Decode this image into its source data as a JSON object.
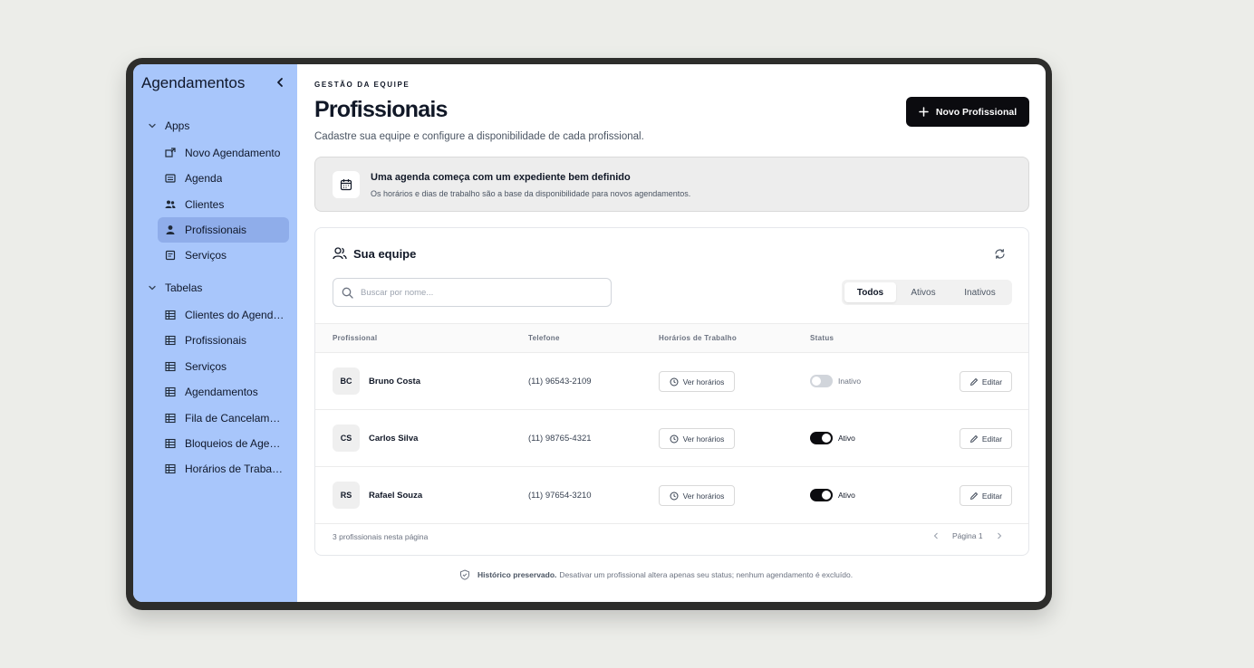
{
  "sidebar": {
    "title": "Agendamentos",
    "sections": [
      {
        "label": "Apps"
      },
      {
        "label": "Tabelas"
      }
    ],
    "apps": [
      {
        "label": "Novo Agendamento",
        "icon": "new-window-icon"
      },
      {
        "label": "Agenda",
        "icon": "calendar-list-icon"
      },
      {
        "label": "Clientes",
        "icon": "users-icon"
      },
      {
        "label": "Profissionais",
        "icon": "user-icon",
        "active": true
      },
      {
        "label": "Serviços",
        "icon": "document-icon"
      }
    ],
    "tables": [
      {
        "label": "Clientes do Agendamento",
        "icon": "table-icon"
      },
      {
        "label": "Profissionais",
        "icon": "table-icon"
      },
      {
        "label": "Serviços",
        "icon": "table-icon"
      },
      {
        "label": "Agendamentos",
        "icon": "table-icon"
      },
      {
        "label": "Fila de Cancelamento",
        "icon": "table-icon"
      },
      {
        "label": "Bloqueios de Agenda",
        "icon": "table-icon"
      },
      {
        "label": "Horários de Trabalho",
        "icon": "table-icon"
      }
    ]
  },
  "header": {
    "eyebrow": "GESTÃO DA EQUIPE",
    "title": "Profissionais",
    "subtitle": "Cadastre sua equipe e configure a disponibilidade de cada profissional.",
    "new_button": "Novo Profissional"
  },
  "banner": {
    "title": "Uma agenda começa com um expediente bem definido",
    "description": "Os horários e dias de trabalho são a base da disponibilidade para novos agendamentos."
  },
  "team": {
    "title": "Sua equipe",
    "search_placeholder": "Buscar por nome...",
    "filters": [
      "Todos",
      "Ativos",
      "Inativos"
    ],
    "selected_filter": "Todos",
    "columns": [
      "Profissional",
      "Telefone",
      "Horários de Trabalho",
      "Status"
    ],
    "rows": [
      {
        "initials": "BC",
        "name": "Bruno Costa",
        "phone": "(11) 96543-2109",
        "hours_label": "Ver horários",
        "active": false,
        "status": "Inativo",
        "edit_label": "Editar"
      },
      {
        "initials": "CS",
        "name": "Carlos Silva",
        "phone": "(11) 98765-4321",
        "hours_label": "Ver horários",
        "active": true,
        "status": "Ativo",
        "edit_label": "Editar"
      },
      {
        "initials": "RS",
        "name": "Rafael Souza",
        "phone": "(11) 97654-3210",
        "hours_label": "Ver horários",
        "active": true,
        "status": "Ativo",
        "edit_label": "Editar"
      }
    ],
    "count_text": "3 profissionais nesta página",
    "page_label": "Página 1"
  },
  "note": {
    "strong": "Histórico preservado.",
    "text": "Desativar um profissional altera apenas seu status; nenhum agendamento é excluído."
  },
  "colors": {
    "sidebar_bg": "#a8c6fb",
    "sidebar_active": "#8fadea",
    "primary": "#0b0b0f",
    "page_bg": "#ecede9"
  }
}
